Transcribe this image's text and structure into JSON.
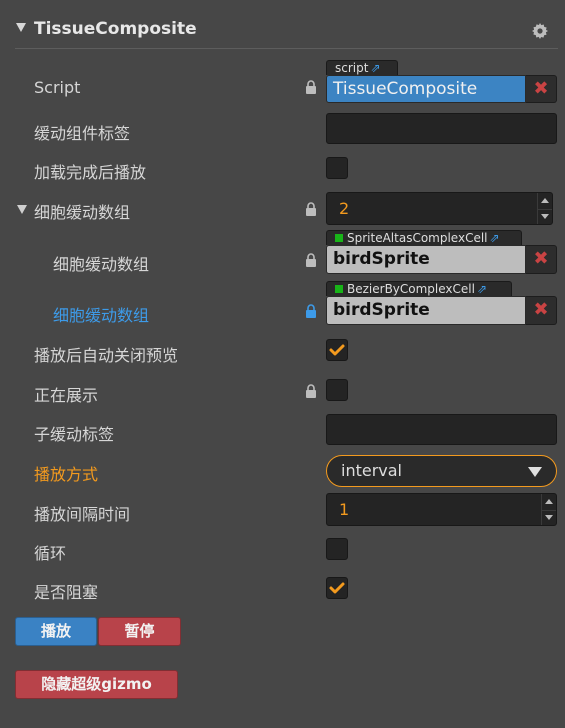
{
  "component": {
    "title": "TissueComposite"
  },
  "fields": {
    "script": {
      "label": "Script",
      "tag": "script",
      "value": "TissueComposite"
    },
    "sub_tag": {
      "label": "缓动组件标签",
      "value": ""
    },
    "autoplay": {
      "label": "加载完成后播放",
      "checked": false
    },
    "cell_array": {
      "label": "细胞缓动数组",
      "value": "2"
    },
    "cell_0": {
      "label": "细胞缓动数组",
      "tag": "SpriteAltasComplexCell",
      "value": "birdSprite"
    },
    "cell_1": {
      "label": "细胞缓动数组",
      "tag": "BezierByComplexCell",
      "value": "birdSprite"
    },
    "auto_close": {
      "label": "播放后自动关闭预览",
      "checked": true
    },
    "showing": {
      "label": "正在展示",
      "checked": false
    },
    "child_tag": {
      "label": "子缓动标签",
      "value": ""
    },
    "play_mode": {
      "label": "播放方式",
      "value": "interval"
    },
    "play_interval": {
      "label": "播放间隔时间",
      "value": "1"
    },
    "loop": {
      "label": "循环",
      "checked": false
    },
    "blocking": {
      "label": "是否阻塞",
      "checked": true
    }
  },
  "buttons": {
    "play": "播放",
    "pause": "暂停",
    "hide_gizmo": "隐藏超级gizmo"
  },
  "icons": {
    "settings": "gear-icon",
    "lock": "lock-icon",
    "remove": "close-icon",
    "external": "external-link-icon",
    "checkmark": "check-icon"
  },
  "colors": {
    "accent_orange": "#f39a1e",
    "accent_blue": "#3d9be9",
    "danger_red": "#b8434a",
    "type_green": "#18b418"
  }
}
